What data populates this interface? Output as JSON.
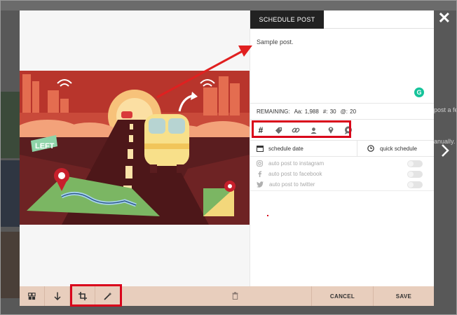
{
  "window": {
    "close_glyph": "✕",
    "next_glyph": "›"
  },
  "background": {
    "fragments": [
      "post a few",
      "anually.",
      "LEFT",
      "Instagram"
    ]
  },
  "tab": {
    "label": "SCHEDULE POST"
  },
  "post": {
    "caption": "Sample post.",
    "grammarly_letter": "G"
  },
  "remaining": {
    "label": "REMAINING:",
    "chars": "Aa: 1,988",
    "hashtags": "#: 30",
    "mentions": "@: 20"
  },
  "tools": [
    {
      "name": "hashtag-icon",
      "glyph": "#"
    },
    {
      "name": "tag-icon",
      "glyph": ""
    },
    {
      "name": "link-icon",
      "glyph": ""
    },
    {
      "name": "user-icon",
      "glyph": ""
    },
    {
      "name": "location-pin-icon",
      "glyph": ""
    },
    {
      "name": "comment-icon",
      "glyph": ""
    }
  ],
  "schedule": {
    "date_label": "schedule date",
    "quick_label": "quick schedule"
  },
  "autopost": [
    {
      "label": "auto post to instagram",
      "icon": "instagram-icon"
    },
    {
      "label": "auto post to facebook",
      "icon": "facebook-icon"
    },
    {
      "label": "auto post to twitter",
      "icon": "twitter-icon"
    }
  ],
  "footer": {
    "cancel_label": "CANCEL",
    "save_label": "SAVE"
  },
  "colors": {
    "highlight": "#d9001a",
    "footer": "#e8cebd",
    "accent_green": "#15c39a"
  },
  "image": {
    "sign_text": "LEFT"
  }
}
